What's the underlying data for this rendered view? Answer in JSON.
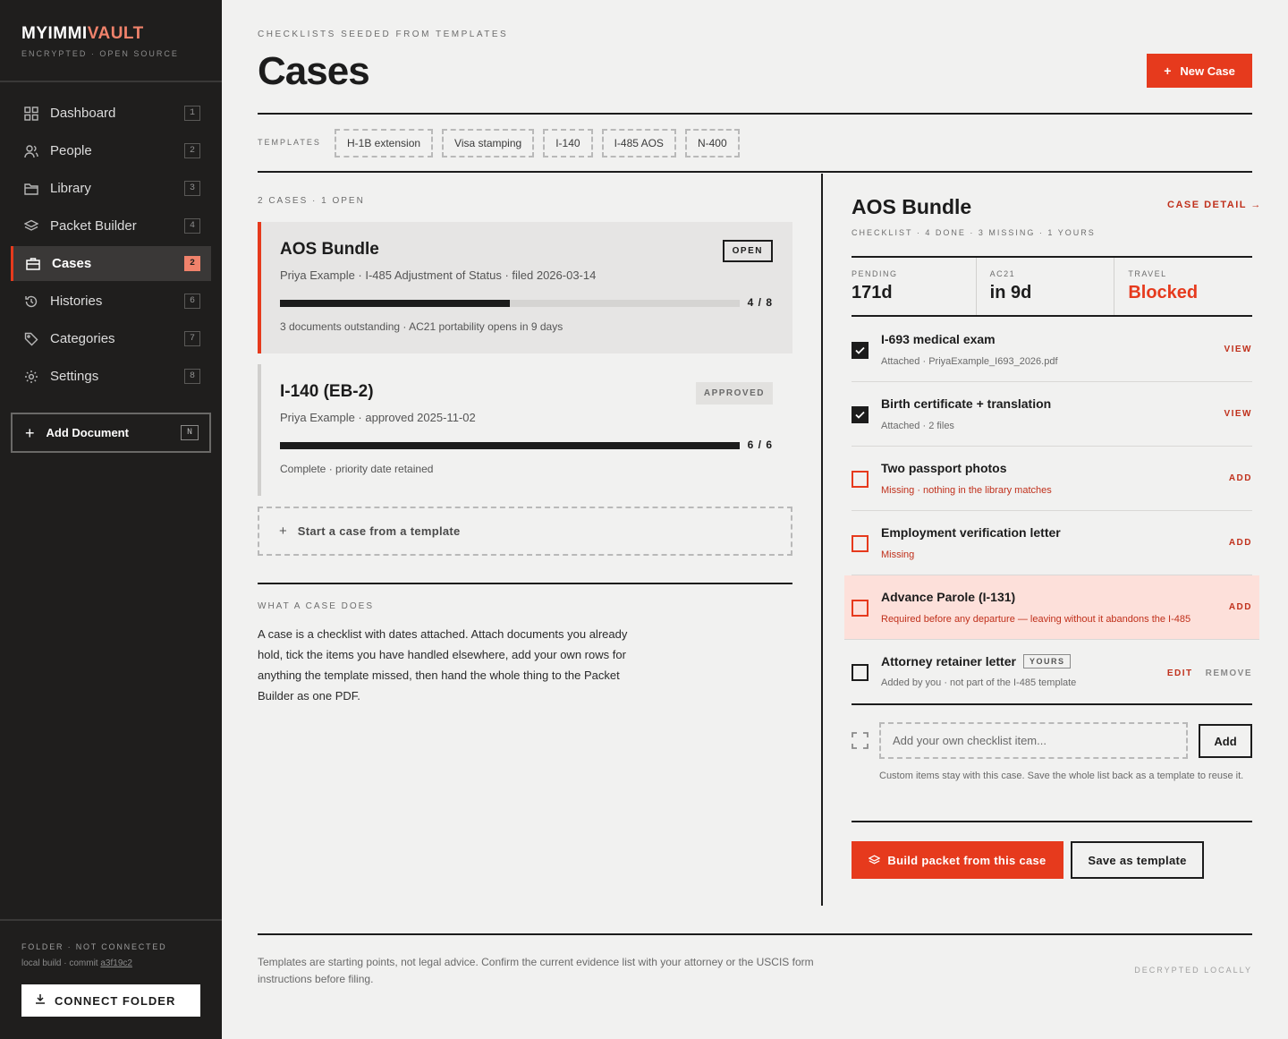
{
  "brand": {
    "name_main": "MYIMMI",
    "name_accent": "VAULT",
    "tagline": "ENCRYPTED · OPEN SOURCE"
  },
  "nav": [
    {
      "label": "Dashboard",
      "key": "1",
      "icon": "grid-icon"
    },
    {
      "label": "People",
      "key": "2",
      "icon": "people-icon"
    },
    {
      "label": "Library",
      "key": "3",
      "icon": "folder-icon"
    },
    {
      "label": "Packet Builder",
      "key": "4",
      "icon": "layers-icon"
    },
    {
      "label": "Cases",
      "key": "2",
      "icon": "briefcase-icon",
      "active": true
    },
    {
      "label": "Histories",
      "key": "6",
      "icon": "history-icon"
    },
    {
      "label": "Categories",
      "key": "7",
      "icon": "tag-icon"
    },
    {
      "label": "Settings",
      "key": "8",
      "icon": "gear-icon"
    }
  ],
  "add_document": {
    "label": "Add Document",
    "key": "N"
  },
  "sidebar_footer": {
    "folder_status": "FOLDER · NOT CONNECTED",
    "build_prefix": "local build · commit ",
    "commit": "a3f19c2",
    "connect_label": "CONNECT FOLDER"
  },
  "header": {
    "eyebrow": "CHECKLISTS SEEDED FROM TEMPLATES",
    "title": "Cases",
    "new_case": "New Case"
  },
  "templates": {
    "label": "TEMPLATES",
    "items": [
      "H-1B extension",
      "Visa stamping",
      "I-140",
      "I-485 AOS",
      "N-400"
    ]
  },
  "cases": {
    "count_label": "2 CASES · 1 OPEN",
    "items": [
      {
        "title": "AOS Bundle",
        "subtitle": "Priya Example · I-485 Adjustment of Status · filed 2026-03-14",
        "badge": "OPEN",
        "progress": 0.5,
        "fraction": "4 / 8",
        "note": "3 documents outstanding · AC21 portability opens in 9 days"
      },
      {
        "title": "I-140 (EB-2)",
        "subtitle": "Priya Example · approved 2025-11-02",
        "badge": "APPROVED",
        "progress": 1.0,
        "fraction": "6 / 6",
        "note": "Complete · priority date retained"
      }
    ],
    "start_template": "Start a case from a template"
  },
  "about": {
    "label": "WHAT A CASE DOES",
    "body": "A case is a checklist with dates attached. Attach documents you already hold, tick the items you have handled elsewhere, add your own rows for anything the template missed, then hand the whole thing to the Packet Builder as one PDF."
  },
  "detail": {
    "title": "AOS Bundle",
    "link": "CASE DETAIL →",
    "subtitle": "CHECKLIST · 4 DONE · 3 MISSING · 1 YOURS",
    "stats": [
      {
        "label": "PENDING",
        "value": "171d"
      },
      {
        "label": "AC21",
        "value": "in 9d"
      },
      {
        "label": "TRAVEL",
        "value": "Blocked",
        "color": "#e63a1d"
      }
    ],
    "checklist": [
      {
        "title": "I-693 medical exam",
        "sub": "Attached · PriyaExample_I693_2026.pdf",
        "action": "VIEW",
        "done": true
      },
      {
        "title": "Birth certificate + translation",
        "sub": "Attached · 2 files",
        "action": "VIEW",
        "done": true
      },
      {
        "title": "Two passport photos",
        "sub": "Missing · nothing in the library matches",
        "action": "ADD",
        "done": false
      },
      {
        "title": "Employment verification letter",
        "sub": "Missing",
        "action": "ADD",
        "done": false
      },
      {
        "title": "Advance Parole (I-131)",
        "sub": "Required before any departure — leaving without it abandons the I-485",
        "action": "ADD",
        "done": false
      },
      {
        "title": "Attorney retainer letter",
        "badge": "YOURS",
        "sub": "Added by you · not part of the I-485 template",
        "edit": "EDIT",
        "remove": "REMOVE",
        "done": false
      }
    ],
    "add_item": {
      "placeholder": "Add your own checklist item...",
      "button": "Add",
      "help": "Custom items stay with this case. Save the whole list back as a template to reuse it."
    },
    "build_button": "Build packet from this case",
    "save_template": "Save as template"
  },
  "footer": {
    "note": "Templates are starting points, not legal advice. Confirm the current evidence list with your attorney or the USCIS form instructions before filing.",
    "right": "DECRYPTED LOCALLY"
  },
  "colors": {
    "accent": "#e63a1d",
    "brand_accent": "#f0826b",
    "sidebar_bg": "#1f1e1d",
    "page_bg": "#f1f1f0",
    "highlight_row": "#fde0da"
  }
}
